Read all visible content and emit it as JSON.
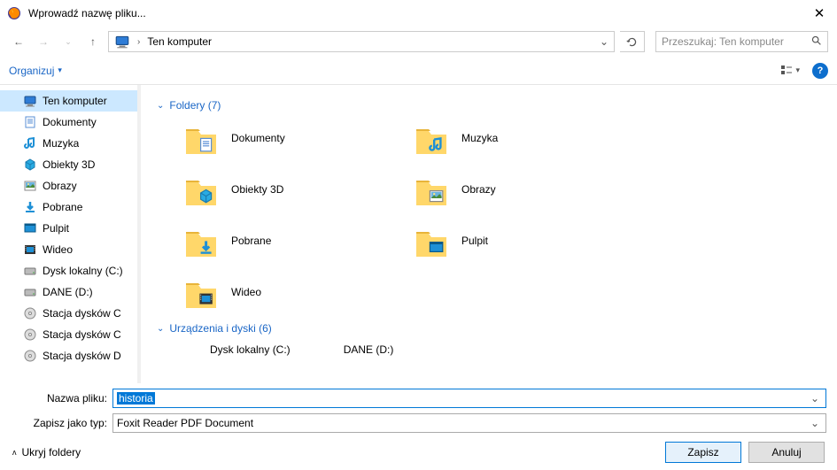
{
  "window": {
    "title": "Wprowadź nazwę pliku..."
  },
  "addressbar": {
    "crumb": "Ten komputer",
    "dropdown_glyph": "⌄"
  },
  "search": {
    "placeholder": "Przeszukaj: Ten komputer"
  },
  "toolbar": {
    "organize": "Organizuj",
    "help_glyph": "?"
  },
  "sidebar": {
    "items": [
      {
        "label": "Ten komputer",
        "icon": "pc",
        "selected": true
      },
      {
        "label": "Dokumenty",
        "icon": "doc"
      },
      {
        "label": "Muzyka",
        "icon": "music"
      },
      {
        "label": "Obiekty 3D",
        "icon": "3d"
      },
      {
        "label": "Obrazy",
        "icon": "pic"
      },
      {
        "label": "Pobrane",
        "icon": "down"
      },
      {
        "label": "Pulpit",
        "icon": "desk"
      },
      {
        "label": "Wideo",
        "icon": "vid"
      },
      {
        "label": "Dysk lokalny (C:)",
        "icon": "disk"
      },
      {
        "label": "DANE (D:)",
        "icon": "disk"
      },
      {
        "label": "Stacja dysków C",
        "icon": "cd"
      },
      {
        "label": "Stacja dysków C",
        "icon": "cd"
      },
      {
        "label": "Stacja dysków D",
        "icon": "cd"
      }
    ]
  },
  "main": {
    "group1_label": "Foldery (7)",
    "folders": [
      {
        "label": "Dokumenty",
        "icon": "doc"
      },
      {
        "label": "Muzyka",
        "icon": "music"
      },
      {
        "label": "Obiekty 3D",
        "icon": "3d"
      },
      {
        "label": "Obrazy",
        "icon": "pic"
      },
      {
        "label": "Pobrane",
        "icon": "down"
      },
      {
        "label": "Pulpit",
        "icon": "desk"
      },
      {
        "label": "Wideo",
        "icon": "vid"
      }
    ],
    "group2_label": "Urządzenia i dyski (6)",
    "disks": [
      {
        "label": "Dysk lokalny (C:)"
      },
      {
        "label": "DANE (D:)"
      }
    ]
  },
  "fields": {
    "filename_label": "Nazwa pliku:",
    "filename_value": "historia",
    "type_label": "Zapisz jako typ:",
    "type_value": "Foxit Reader PDF Document"
  },
  "footer": {
    "hide_folders": "Ukryj foldery",
    "save": "Zapisz",
    "cancel": "Anuluj"
  }
}
